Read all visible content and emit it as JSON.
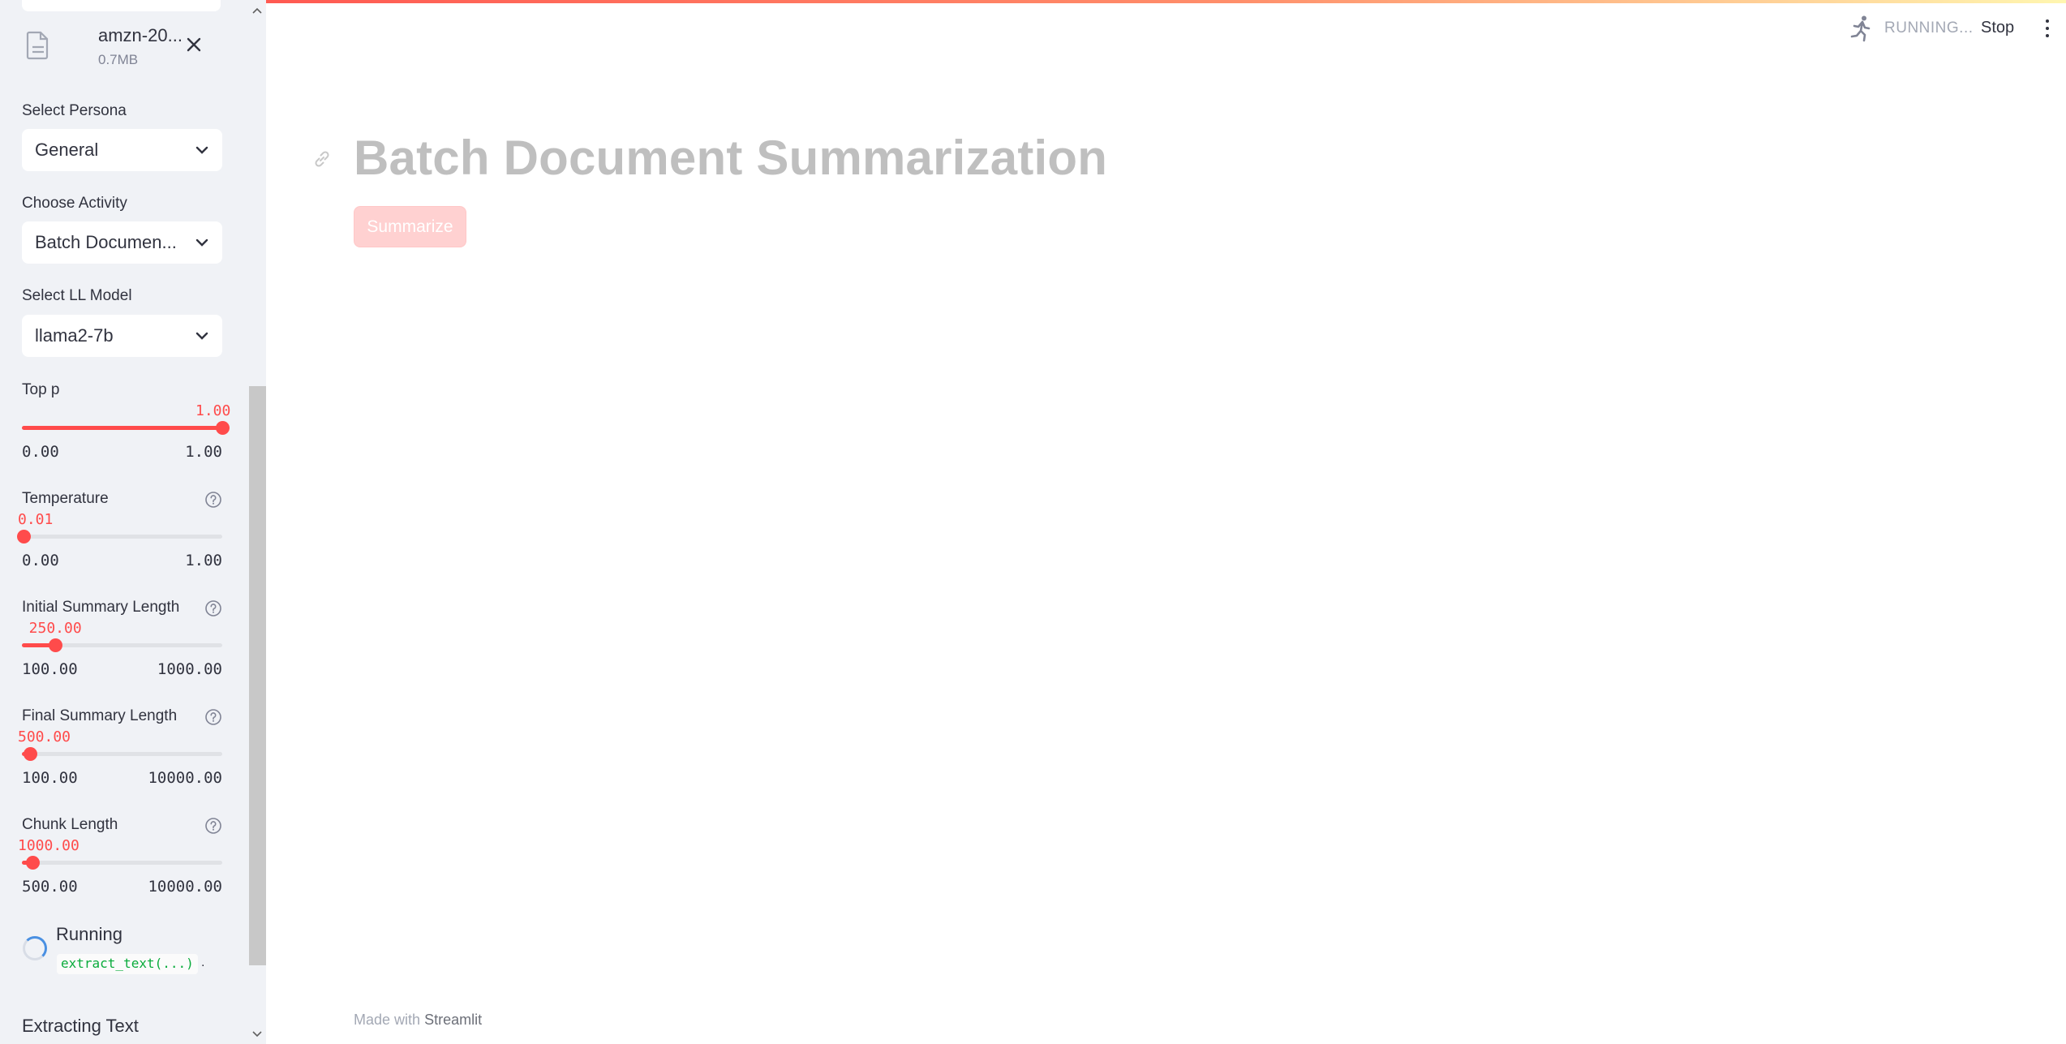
{
  "colors": {
    "accent": "#ff4b4b",
    "sidebar_bg": "#f0f2f6",
    "code_green": "#09ab3b"
  },
  "sidebar": {
    "file": {
      "name": "amzn-20...",
      "size": "0.7MB",
      "icon": "file-icon"
    },
    "persona": {
      "label": "Select Persona",
      "value": "General"
    },
    "activity": {
      "label": "Choose Activity",
      "value": "Batch Documen..."
    },
    "model": {
      "label": "Select LL Model",
      "value": "llama2-7b"
    },
    "sliders": [
      {
        "label": "Top p",
        "value": "1.00",
        "min": "0.00",
        "max": "1.00",
        "fraction": 1.0,
        "has_help": false
      },
      {
        "label": "Temperature",
        "value": "0.01",
        "min": "0.00",
        "max": "1.00",
        "fraction": 0.01,
        "has_help": true
      },
      {
        "label": "Initial Summary Length",
        "value": "250.00",
        "min": "100.00",
        "max": "1000.00",
        "fraction": 0.1667,
        "has_help": true
      },
      {
        "label": "Final Summary Length",
        "value": "500.00",
        "min": "100.00",
        "max": "10000.00",
        "fraction": 0.0404,
        "has_help": true
      },
      {
        "label": "Chunk Length",
        "value": "1000.00",
        "min": "500.00",
        "max": "10000.00",
        "fraction": 0.0526,
        "has_help": true
      }
    ],
    "status": {
      "label": "Running",
      "code": "extract_text(...)",
      "suffix": "."
    },
    "progress_heading": "Extracting Text"
  },
  "header": {
    "running_text": "RUNNING...",
    "stop_label": "Stop"
  },
  "main": {
    "title": "Batch Document Summarization",
    "summarize_label": "Summarize"
  },
  "footer": {
    "prefix": "Made with",
    "brand": "Streamlit"
  }
}
